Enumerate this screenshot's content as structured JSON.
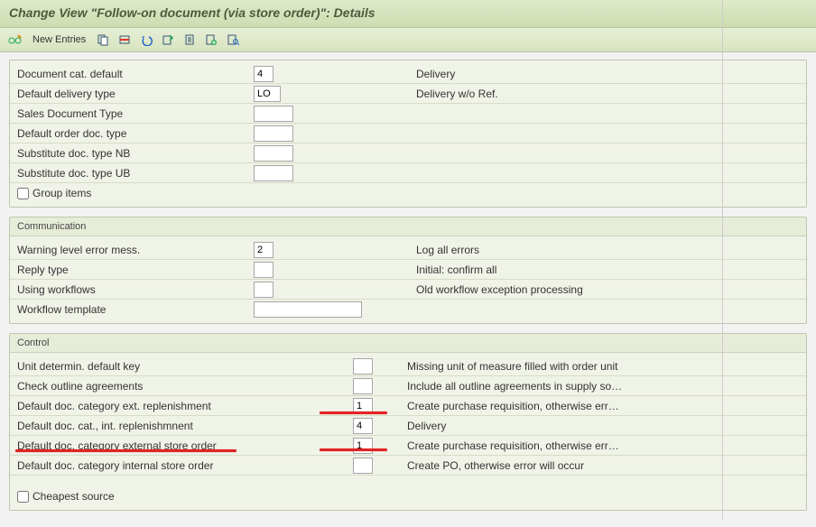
{
  "title": "Change View \"Follow-on document (via store order)\": Details",
  "toolbar": {
    "new_entries": "New Entries"
  },
  "group1": {
    "row0": {
      "label": "Document cat. default",
      "value": "4",
      "desc": "Delivery"
    },
    "row1": {
      "label": "Default delivery type",
      "value": "LO",
      "desc": "Delivery w/o Ref."
    },
    "row2": {
      "label": "Sales Document Type",
      "value": ""
    },
    "row3": {
      "label": "Default order doc. type",
      "value": ""
    },
    "row4": {
      "label": "Substitute doc. type NB",
      "value": ""
    },
    "row5": {
      "label": "Substitute doc. type UB",
      "value": ""
    },
    "check_group": "Group items"
  },
  "group2": {
    "title": "Communication",
    "row0": {
      "label": "Warning level error mess.",
      "value": "2",
      "desc": "Log all errors"
    },
    "row1": {
      "label": "Reply type",
      "value": "",
      "desc": "Initial: confirm all"
    },
    "row2": {
      "label": "Using workflows",
      "value": "",
      "desc": "Old workflow exception processing"
    },
    "row3": {
      "label": "Workflow template",
      "value": ""
    }
  },
  "group3": {
    "title": "Control",
    "row0": {
      "label": "Unit determin. default key",
      "value": "",
      "desc": "Missing unit of measure filled with order unit"
    },
    "row1": {
      "label": "Check outline agreements",
      "value": "",
      "desc": "Include all outline agreements in supply so…"
    },
    "row2": {
      "label": "Default doc. category ext. replenishment",
      "value": "1",
      "desc": "Create purchase requisition, otherwise err…"
    },
    "row3": {
      "label": "Default doc. cat., int. replenishmnent",
      "value": "4",
      "desc": "Delivery"
    },
    "row4": {
      "label": "Default doc. category external store order",
      "value": "1",
      "desc": "Create purchase requisition, otherwise err…"
    },
    "row5": {
      "label": "Default doc. category internal store order",
      "value": "",
      "desc": "Create PO, otherwise error will occur"
    },
    "check_cheapest": "Cheapest source"
  }
}
